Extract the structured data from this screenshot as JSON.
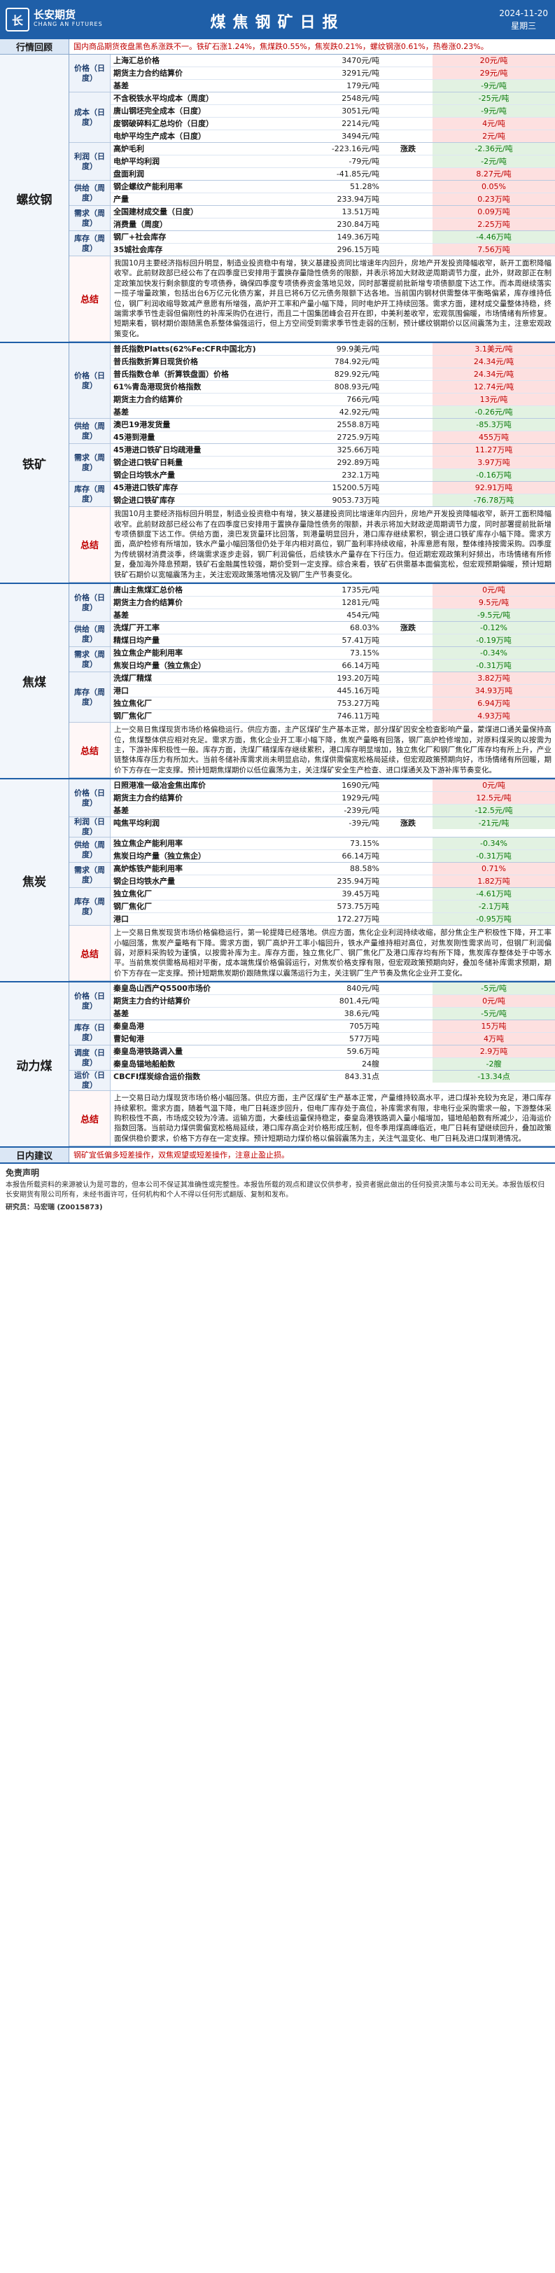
{
  "header": {
    "brand_cn": "长安期货",
    "brand_en": "CHANG AN FUTURES",
    "title": "煤焦钢矿日报",
    "date": "2024-11-20",
    "weekday": "星期三"
  },
  "review": {
    "label": "行情回顾",
    "text": "国内商品期货夜盘黑色系涨跌不一。铁矿石涨1.24%，焦煤跌0.55%，焦炭跌0.21%，螺纹钢涨0.61%，热卷涨0.23%。"
  },
  "colors": {
    "up": "#c00000",
    "down": "#0a7a0a",
    "brand": "#1f5fa8"
  },
  "sections": [
    {
      "name": "螺纹钢",
      "sum_label": "总结",
      "groups": [
        {
          "label": "价格（日度）",
          "rows": [
            [
              "上海汇总价格",
              "3470元/吨",
              "",
              "20元/吨",
              "up"
            ],
            [
              "期货主力合约结算价",
              "3291元/吨",
              "",
              "29元/吨",
              "up"
            ],
            [
              "基差",
              "179元/吨",
              "",
              "-9元/吨",
              "dn"
            ]
          ]
        },
        {
          "label": "成本（日度）",
          "rows": [
            [
              "不含税铁水平均成本（周度）",
              "2548元/吨",
              "",
              "-25元/吨",
              "dn"
            ],
            [
              "唐山钢坯完全成本（日度）",
              "3051元/吨",
              "",
              "-9元/吨",
              "dn"
            ],
            [
              "废钢破碎料汇总均价（日度）",
              "2214元/吨",
              "",
              "4元/吨",
              "up"
            ],
            [
              "电炉平均生产成本（日度）",
              "3494元/吨",
              "",
              "2元/吨",
              "up"
            ]
          ]
        },
        {
          "label": "利润（日度）",
          "rows": [
            [
              "高炉毛利",
              "-223.16元/吨",
              "涨跌",
              "-2.36元/吨",
              "dn"
            ],
            [
              "电炉平均利润",
              "-79元/吨",
              "",
              "-2元/吨",
              "dn"
            ],
            [
              "盘面利润",
              "-41.85元/吨",
              "",
              "8.27元/吨",
              "up"
            ]
          ]
        },
        {
          "label": "供给（周度）",
          "rows": [
            [
              "钢企螺纹产能利用率",
              "51.28%",
              "",
              "0.05%",
              "up"
            ],
            [
              "产量",
              "233.94万吨",
              "",
              "0.23万吨",
              "up"
            ]
          ]
        },
        {
          "label": "需求（周度）",
          "rows": [
            [
              "全国建材成交量（日度）",
              "13.51万吨",
              "",
              "0.09万吨",
              "up"
            ],
            [
              "消费量（周度）",
              "230.84万吨",
              "",
              "2.25万吨",
              "up"
            ]
          ]
        },
        {
          "label": "库存（周度）",
          "rows": [
            [
              "钢厂+社会库存",
              "149.36万吨",
              "",
              "-4.46万吨",
              "dn"
            ],
            [
              "35城社会库存",
              "296.15万吨",
              "",
              "7.56万吨",
              "up"
            ]
          ]
        }
      ],
      "summary": "我国10月主要经济指标回升明显，制造业投资稳中有增，狭义基建投资同比增速年内回升，房地产开发投资降幅收窄，新开工面积降幅收窄。此前财政部已经公布了在四季度已安排用于置换存量隐性债务的限额，并表示将加大财政逆周期调节力度，此外，财政部正在制定政策加快发行剩余额度的专项债券，确保四季度专项债券资金落地见效，同时部署提前批新增专项债额度下达工作。而本周继续落实一揽子增量政策，包括出台6万亿元化债方案，并且已将6万亿元债务限额下达各地。当前国内钢材供需整体平衡略偏紧，库存维持低位，钢厂利润收缩导致减产意愿有所增强，高炉开工率和产量小幅下降，同时电炉开工持续回落。需求方面，建材成交量整体持稳，终端需求季节性走弱但偏刚性的补库采购仍在进行，而且二十国集团峰会召开在即，中美利差收窄，宏观氛围偏暖，市场情绪有所修复。短期来看，钢材期价跟随黑色系整体偏强运行，但上方空间受到需求季节性走弱的压制，预计螺纹钢期价以区间震荡为主，注意宏观政策变化。"
    },
    {
      "name": "铁矿",
      "sum_label": "总结",
      "groups": [
        {
          "label": "价格（日度）",
          "rows": [
            [
              "普氏指数Platts(62%Fe:CFR中国北方)",
              "99.9美元/吨",
              "",
              "3.1美元/吨",
              "up"
            ],
            [
              "普氏指数折算日现货价格",
              "784.92元/吨",
              "",
              "24.34元/吨",
              "up"
            ],
            [
              "普氏指数仓单（折算铁盘面）价格",
              "829.92元/吨",
              "",
              "24.34元/吨",
              "up"
            ],
            [
              "61%青岛港现货价格指数",
              "808.93元/吨",
              "",
              "12.74元/吨",
              "up"
            ],
            [
              "期货主力合约结算价",
              "766元/吨",
              "",
              "13元/吨",
              "up"
            ],
            [
              "基差",
              "42.92元/吨",
              "",
              "-0.26元/吨",
              "dn"
            ]
          ]
        },
        {
          "label": "供给（周度）",
          "rows": [
            [
              "澳巴19港发货量",
              "2558.8万吨",
              "",
              "-85.3万吨",
              "dn"
            ],
            [
              "45港到港量",
              "2725.9万吨",
              "",
              "455万吨",
              "up"
            ]
          ]
        },
        {
          "label": "需求（周度）",
          "rows": [
            [
              "45港进口铁矿日均疏港量",
              "325.66万吨",
              "",
              "11.27万吨",
              "up"
            ],
            [
              "钢企进口铁矿日耗量",
              "292.89万吨",
              "",
              "3.97万吨",
              "up"
            ],
            [
              "钢企日均铁水产量",
              "232.1万吨",
              "",
              "-0.16万吨",
              "dn"
            ]
          ]
        },
        {
          "label": "库存（周度）",
          "rows": [
            [
              "45港进口铁矿库存",
              "15200.5万吨",
              "",
              "92.91万吨",
              "up"
            ],
            [
              "钢企进口铁矿库存",
              "9053.73万吨",
              "",
              "-76.78万吨",
              "dn"
            ]
          ]
        }
      ],
      "summary": "我国10月主要经济指标回升明显，制造业投资稳中有增，狭义基建投资同比增速年内回升，房地产开发投资降幅收窄，新开工面积降幅收窄。此前财政部已经公布了在四季度已安排用于置换存量隐性债务的限额，并表示将加大财政逆周期调节力度，同时部署提前批新增专项债额度下达工作。供给方面，澳巴发货量环比回落，到港量明显回升，港口库存继续累积，钢企进口铁矿库存小幅下降。需求方面，高炉检修有所增加，铁水产量小幅回落但仍处于年内相对高位，钢厂盈利率持续收缩，补库意愿有限，整体维持按需采购。四季度为传统钢材消费淡季，终端需求逐步走弱，钢厂利润偏低，后续铁水产量存在下行压力。但近期宏观政策利好频出，市场情绪有所修复，叠加海外降息预期，铁矿石金融属性较强，期价受到一定支撑。综合来看，铁矿石供需基本面偏宽松，但宏观预期偏暖，预计短期铁矿石期价以宽幅震荡为主，关注宏观政策落地情况及钢厂生产节奏变化。"
    },
    {
      "name": "焦煤",
      "sum_label": "总结",
      "groups": [
        {
          "label": "价格（日度）",
          "rows": [
            [
              "唐山主焦煤汇总价格",
              "1735元/吨",
              "",
              "0元/吨",
              "up"
            ],
            [
              "期货主力合约结算价",
              "1281元/吨",
              "",
              "9.5元/吨",
              "up"
            ],
            [
              "基差",
              "454元/吨",
              "",
              "-9.5元/吨",
              "dn"
            ]
          ]
        },
        {
          "label": "供给（周度）",
          "rows": [
            [
              "洗煤厂开工率",
              "68.03%",
              "涨跌",
              "-0.12%",
              "dn"
            ],
            [
              "精煤日均产量",
              "57.41万吨",
              "",
              "-0.19万吨",
              "dn"
            ]
          ]
        },
        {
          "label": "需求（周度）",
          "rows": [
            [
              "独立焦企产能利用率",
              "73.15%",
              "",
              "-0.34%",
              "dn"
            ],
            [
              "焦炭日均产量（独立焦企）",
              "66.14万吨",
              "",
              "-0.31万吨",
              "dn"
            ]
          ]
        },
        {
          "label": "库存（周度）",
          "rows": [
            [
              "洗煤厂精煤",
              "193.20万吨",
              "",
              "3.82万吨",
              "up"
            ],
            [
              "港口",
              "445.16万吨",
              "",
              "34.93万吨",
              "up"
            ],
            [
              "独立焦化厂",
              "753.27万吨",
              "",
              "6.94万吨",
              "up"
            ],
            [
              "钢厂焦化厂",
              "746.11万吨",
              "",
              "4.93万吨",
              "up"
            ]
          ]
        }
      ],
      "summary": "上一交易日焦煤现货市场价格偏稳运行。供应方面，主产区煤矿生产基本正常，部分煤矿因安全检查影响产量，蒙煤进口通关量保持高位，焦煤整体供应相对充足。需求方面，焦化企业开工率小幅下降，焦炭产量略有回落，钢厂高炉检修增加，对原料煤采购以按需为主，下游补库积极性一般。库存方面，洗煤厂精煤库存继续累积，港口库存明显增加，独立焦化厂和钢厂焦化厂库存均有所上升，产业链整体库存压力有所加大。当前冬储补库需求尚未明显启动，焦煤供需偏宽松格局延续，但宏观政策预期向好，市场情绪有所回暖，期价下方存在一定支撑。预计短期焦煤期价以低位震荡为主，关注煤矿安全生产检查、进口煤通关及下游补库节奏变化。"
    },
    {
      "name": "焦炭",
      "sum_label": "总结",
      "groups": [
        {
          "label": "价格（日度）",
          "rows": [
            [
              "日照港准一级冶金焦出库价",
              "1690元/吨",
              "",
              "0元/吨",
              "up"
            ],
            [
              "期货主力合约结算价",
              "1929元/吨",
              "",
              "12.5元/吨",
              "up"
            ],
            [
              "基差",
              "-239元/吨",
              "",
              "-12.5元/吨",
              "dn"
            ]
          ]
        },
        {
          "label": "利润（日度）",
          "rows": [
            [
              "吨焦平均利润",
              "-39元/吨",
              "涨跌",
              "-21元/吨",
              "dn"
            ]
          ]
        },
        {
          "label": "供给（周度）",
          "rows": [
            [
              "独立焦企产能利用率",
              "73.15%",
              "",
              "-0.34%",
              "dn"
            ],
            [
              "焦炭日均产量（独立焦企）",
              "66.14万吨",
              "",
              "-0.31万吨",
              "dn"
            ]
          ]
        },
        {
          "label": "需求（周度）",
          "rows": [
            [
              "高炉炼铁产能利用率",
              "88.58%",
              "",
              "0.71%",
              "up"
            ],
            [
              "钢企日均铁水产量",
              "235.94万吨",
              "",
              "1.82万吨",
              "up"
            ]
          ]
        },
        {
          "label": "库存（周度）",
          "rows": [
            [
              "独立焦化厂",
              "39.45万吨",
              "",
              "-4.61万吨",
              "dn"
            ],
            [
              "钢厂焦化厂",
              "573.75万吨",
              "",
              "-2.1万吨",
              "dn"
            ],
            [
              "港口",
              "172.27万吨",
              "",
              "-0.95万吨",
              "dn"
            ]
          ]
        }
      ],
      "summary": "上一交易日焦炭现货市场价格偏稳运行，第一轮提降已经落地。供应方面，焦化企业利润持续收缩，部分焦企生产积极性下降，开工率小幅回落，焦炭产量略有下降。需求方面，钢厂高炉开工率小幅回升，铁水产量维持相对高位，对焦炭刚性需求尚可，但钢厂利润偏弱，对原料采购较为谨慎，以按需补库为主。库存方面，独立焦化厂、钢厂焦化厂及港口库存均有所下降，焦炭库存整体处于中等水平。当前焦炭供需格局相对平衡，成本端焦煤价格偏弱运行，对焦炭价格支撑有限，但宏观政策预期向好，叠加冬储补库需求预期，期价下方存在一定支撑。预计短期焦炭期价跟随焦煤以震荡运行为主，关注钢厂生产节奏及焦化企业开工变化。"
    },
    {
      "name": "动力煤",
      "sum_label": "总结",
      "groups": [
        {
          "label": "价格（日度）",
          "rows": [
            [
              "秦皇岛山西产Q5500市场价",
              "840元/吨",
              "",
              "-5元/吨",
              "dn"
            ],
            [
              "期货主力合约计结算价",
              "801.4元/吨",
              "",
              "0元/吨",
              "up"
            ],
            [
              "基差",
              "38.6元/吨",
              "",
              "-5元/吨",
              "dn"
            ]
          ]
        },
        {
          "label": "库存（日度）",
          "rows": [
            [
              "秦皇岛港",
              "705万吨",
              "",
              "15万吨",
              "up"
            ],
            [
              "曹妃甸港",
              "577万吨",
              "",
              "4万吨",
              "up"
            ]
          ]
        },
        {
          "label": "调度（日度）",
          "rows": [
            [
              "秦皇岛港铁路调入量",
              "59.6万吨",
              "",
              "2.9万吨",
              "up"
            ],
            [
              "秦皇岛锚地船舶数",
              "24艘",
              "",
              "-2艘",
              "dn"
            ]
          ]
        },
        {
          "label": "运价（日度）",
          "rows": [
            [
              "CBCFI煤炭综合运价指数",
              "843.31点",
              "",
              "-13.34点",
              "dn"
            ]
          ]
        }
      ],
      "summary": "上一交易日动力煤现货市场价格小幅回落。供应方面，主产区煤矿生产基本正常，产量维持较高水平，进口煤补充较为充足，港口库存持续累积。需求方面，随着气温下降，电厂日耗逐步回升，但电厂库存处于高位，补库需求有限，非电行业采购需求一般，下游整体采购积极性不高，市场成交较为冷清。运输方面，大秦线运量保持稳定，秦皇岛港铁路调入量小幅增加，锚地船舶数有所减少，沿海运价指数回落。当前动力煤供需偏宽松格局延续，港口库存高企对价格形成压制，但冬季用煤高峰临近，电厂日耗有望继续回升，叠加政策面保供稳价要求，价格下方存在一定支撑。预计短期动力煤价格以偏弱震荡为主，关注气温变化、电厂日耗及进口煤到港情况。"
    }
  ],
  "advice": {
    "label": "日内建议",
    "text": "钢矿宜低偏多短差操作，双焦观望或短差操作，注意止盈止损。"
  },
  "footer": {
    "disclaimer_title": "免责声明",
    "disclaimer": "本报告所载资料的来源被认为是可靠的，但本公司不保证其准确性或完整性。本报告所载的观点和建议仅供参考，投资者据此做出的任何投资决策与本公司无关。本报告版权归长安期货有限公司所有，未经书面许可，任何机构和个人不得以任何形式翻版、复制和发布。",
    "analyst": "研究员：马宏瑞 (Z0015873)"
  }
}
